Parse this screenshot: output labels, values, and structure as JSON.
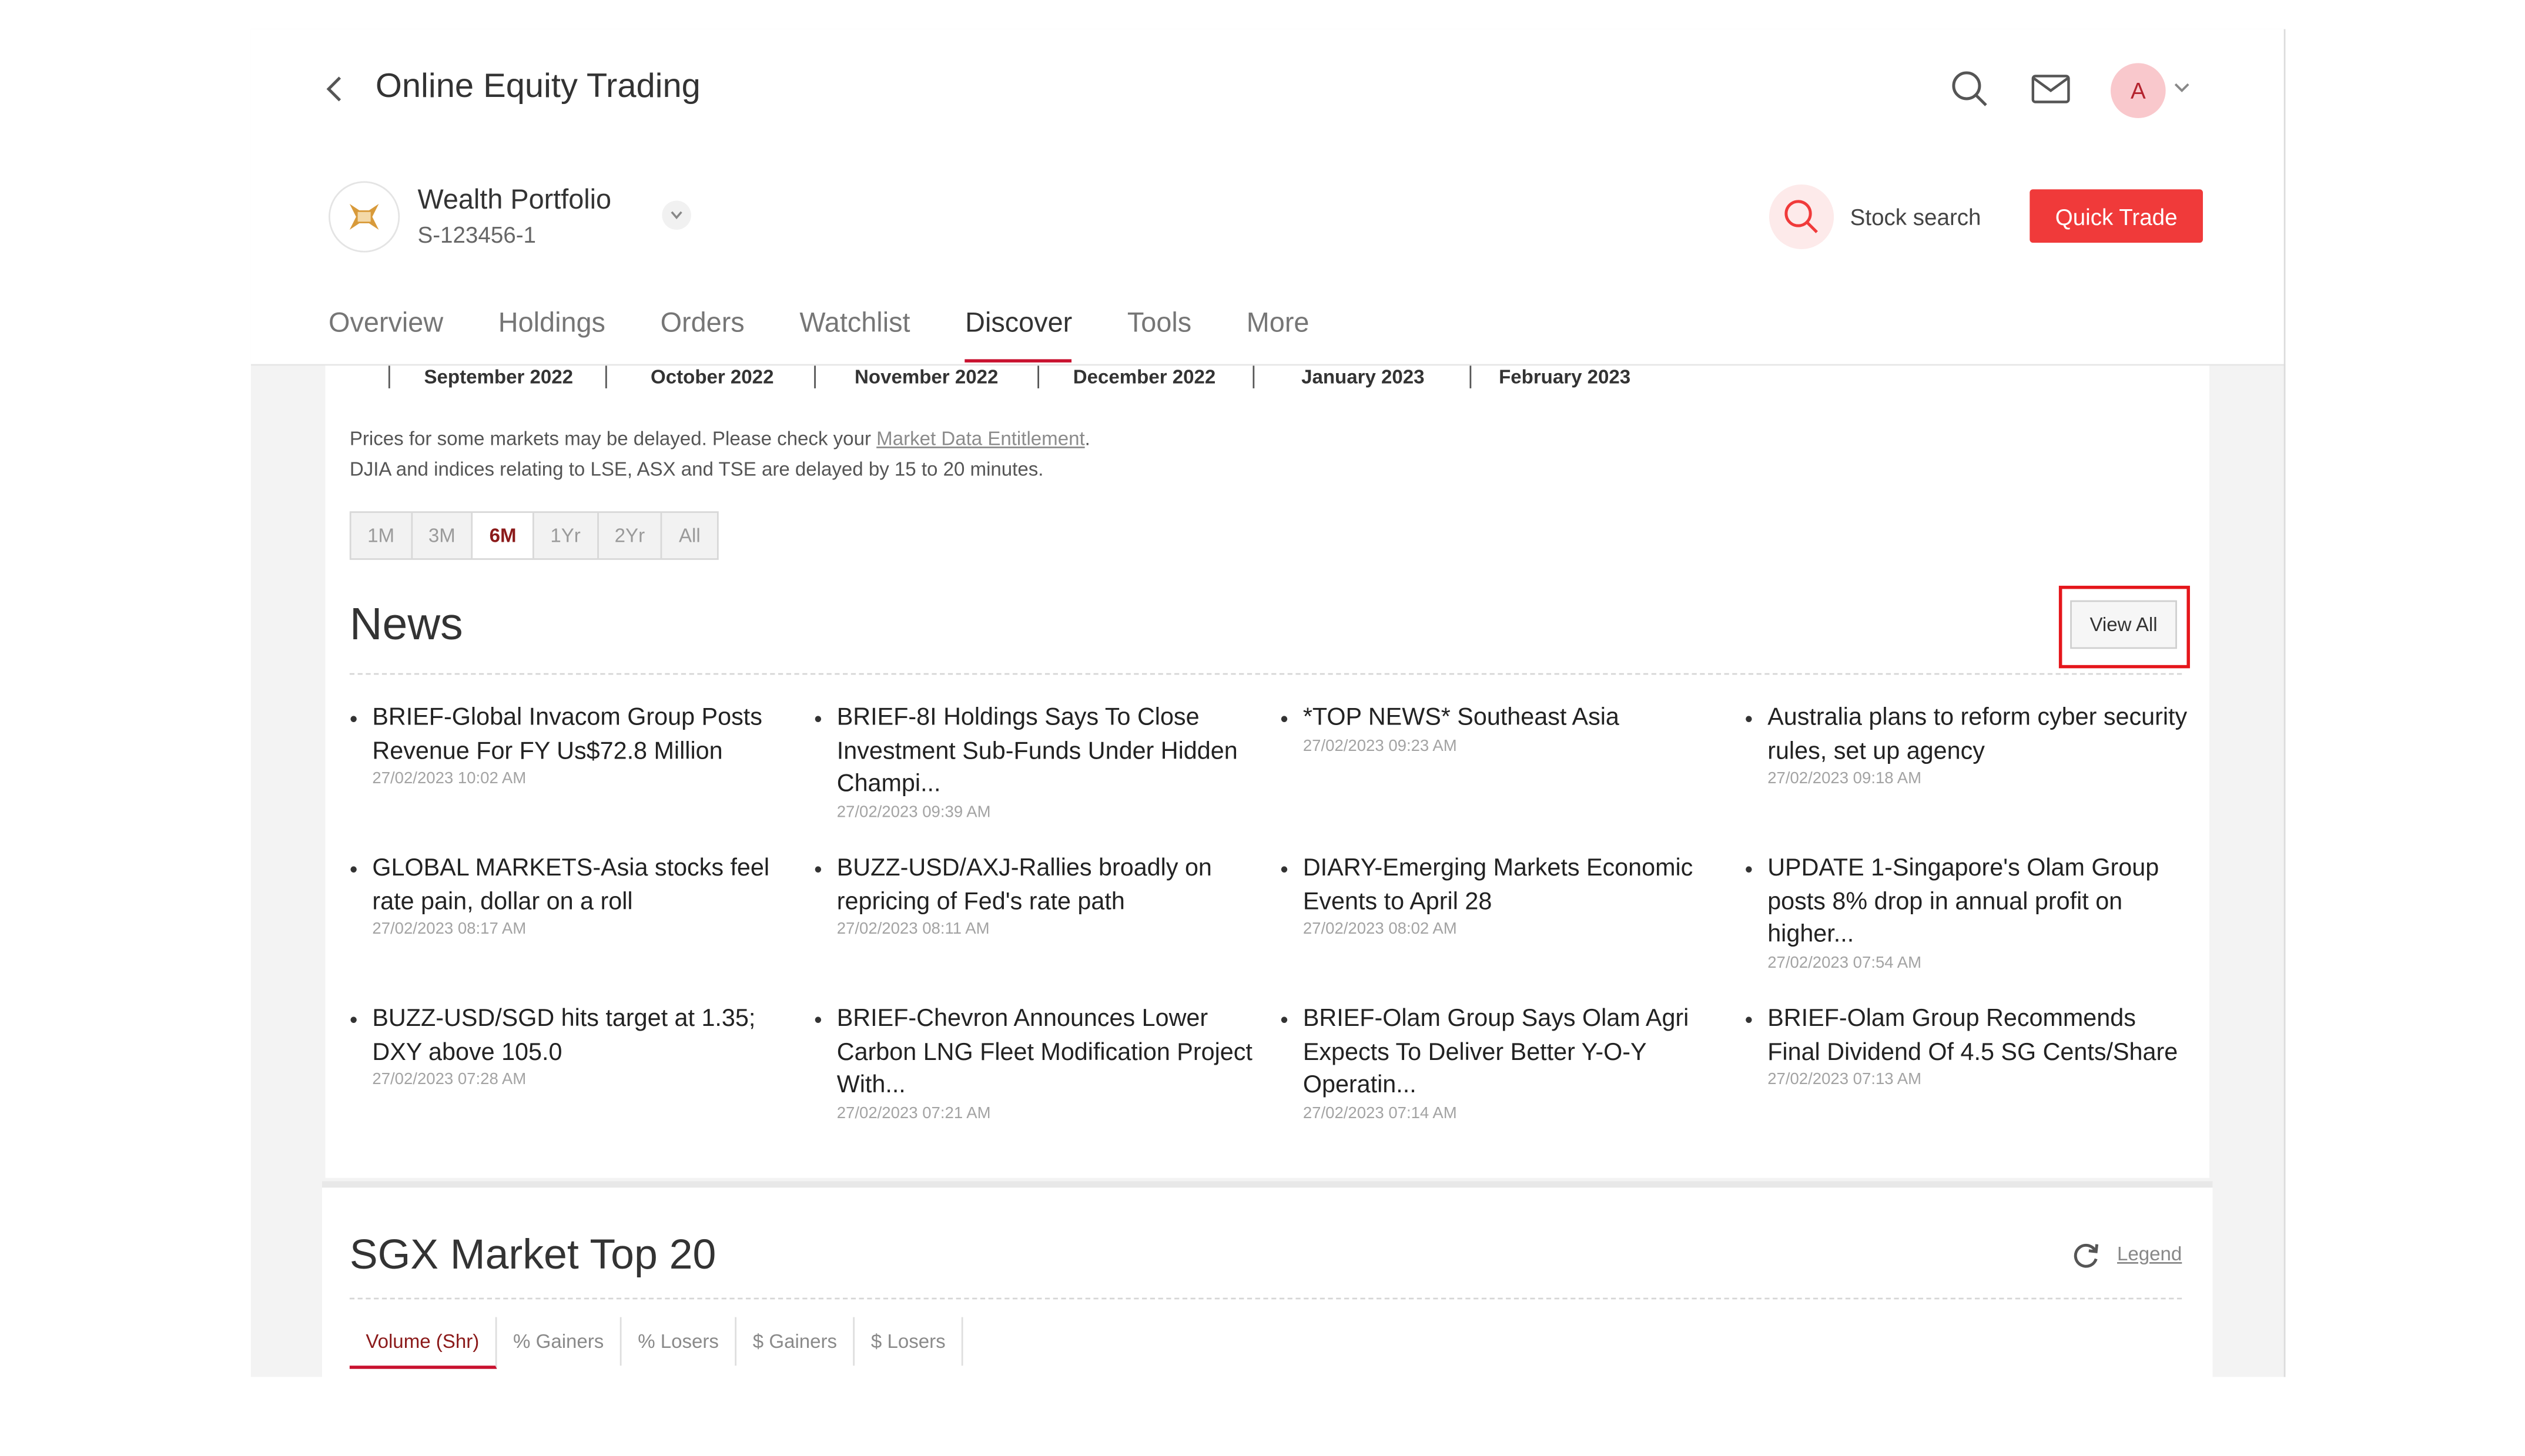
{
  "header": {
    "title": "Online Equity Trading",
    "avatar_initial": "A",
    "portfolio_name": "Wealth Portfolio",
    "portfolio_id": "S-123456-1",
    "stock_search_label": "Stock search",
    "quick_trade_label": "Quick Trade"
  },
  "tabs": [
    "Overview",
    "Holdings",
    "Orders",
    "Watchlist",
    "Discover",
    "Tools",
    "More"
  ],
  "active_tab": "Discover",
  "chart_axis": {
    "months": [
      "September 2022",
      "October 2022",
      "November 2022",
      "December 2022",
      "January 2023",
      "February 2023"
    ]
  },
  "notice": {
    "line1_prefix": "Prices for some markets may be delayed. Please check your ",
    "line1_link": "Market Data Entitlement",
    "line1_suffix": ".",
    "line2": "DJIA and indices relating to LSE, ASX and TSE are delayed by 15 to 20 minutes."
  },
  "ranges": [
    "1M",
    "3M",
    "6M",
    "1Yr",
    "2Yr",
    "All"
  ],
  "active_range": "6M",
  "news": {
    "title": "News",
    "view_all_label": "View All",
    "items": [
      {
        "headline": "BRIEF-Global Invacom Group Posts Revenue For FY Us$72.8 Million",
        "time": "27/02/2023 10:02 AM"
      },
      {
        "headline": "BRIEF-8I Holdings Says To Close Investment Sub-Funds Under Hidden Champi...",
        "time": "27/02/2023 09:39 AM"
      },
      {
        "headline": "*TOP NEWS* Southeast Asia",
        "time": "27/02/2023 09:23 AM"
      },
      {
        "headline": "Australia plans to reform cyber security rules, set up agency",
        "time": "27/02/2023 09:18 AM"
      },
      {
        "headline": "GLOBAL MARKETS-Asia stocks feel rate pain, dollar on a roll",
        "time": "27/02/2023 08:17 AM"
      },
      {
        "headline": "BUZZ-USD/AXJ-Rallies broadly on repricing of Fed's rate path",
        "time": "27/02/2023 08:11 AM"
      },
      {
        "headline": "DIARY-Emerging Markets Economic Events to April 28",
        "time": "27/02/2023 08:02 AM"
      },
      {
        "headline": "UPDATE 1-Singapore's Olam Group posts 8% drop in annual profit on higher...",
        "time": "27/02/2023 07:54 AM"
      },
      {
        "headline": "BUZZ-USD/SGD hits target at 1.35; DXY above 105.0",
        "time": "27/02/2023 07:28 AM"
      },
      {
        "headline": "BRIEF-Chevron Announces Lower Carbon LNG Fleet Modification Project With...",
        "time": "27/02/2023 07:21 AM"
      },
      {
        "headline": "BRIEF-Olam Group Says Olam Agri Expects To Deliver Better Y-O-Y Operatin...",
        "time": "27/02/2023 07:14 AM"
      },
      {
        "headline": "BRIEF-Olam Group Recommends Final Dividend Of 4.5 SG Cents/Share",
        "time": "27/02/2023 07:13 AM"
      }
    ]
  },
  "sgx": {
    "title": "SGX Market Top 20",
    "legend_label": "Legend",
    "tabs": [
      "Volume (Shr)",
      "% Gainers",
      "% Losers",
      "$ Gainers",
      "$ Losers"
    ],
    "active_tab": "Volume (Shr)"
  },
  "colors": {
    "accent": "#f03a3a",
    "highlight_box": "#e5161b",
    "active_tab_underline": "#c8102e"
  }
}
